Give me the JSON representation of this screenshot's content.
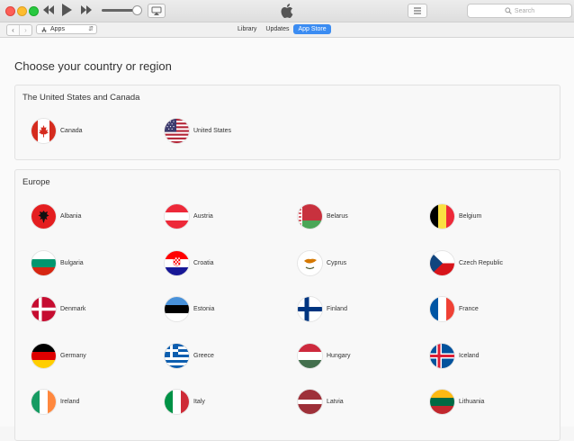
{
  "toolbar": {
    "search_placeholder": "Search"
  },
  "nav": {
    "media_select": "Apps",
    "tabs": [
      {
        "label": "Library",
        "active": false
      },
      {
        "label": "Updates",
        "active": false
      },
      {
        "label": "App Store",
        "active": true
      }
    ]
  },
  "page": {
    "heading": "Choose your country or region",
    "sections": [
      {
        "title": "The United States and Canada",
        "countries": [
          "Canada",
          "United States"
        ]
      },
      {
        "title": "Europe",
        "countries": [
          "Albania",
          "Austria",
          "Belarus",
          "Belgium",
          "Bulgaria",
          "Croatia",
          "Cyprus",
          "Czech Republic",
          "Denmark",
          "Estonia",
          "Finland",
          "France",
          "Germany",
          "Greece",
          "Hungary",
          "Iceland",
          "Ireland",
          "Italy",
          "Latvia",
          "Lithuania"
        ]
      }
    ]
  },
  "colors": {
    "accent": "#3b8cf2",
    "section_bg": "#f8f8f8"
  }
}
